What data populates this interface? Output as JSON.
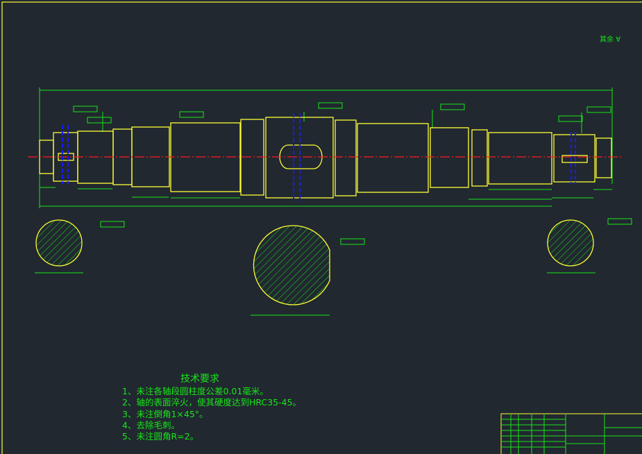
{
  "colors": {
    "background": "#212830",
    "outline": "#ffff33",
    "dimension": "#19e619",
    "centerline": "#ff1a1a",
    "hidden_axis": "#1a1aff"
  },
  "roughness_note": {
    "label": "其余",
    "icon": "surface-roughness-symbol"
  },
  "technical_requirements": {
    "title": "技术要求",
    "items": [
      "1、未注各轴段圆柱度公差0.01毫米。",
      "2、轴的表面淬火，使其硬度达到HRC35-45。",
      "3、未注倒角1×45°。",
      "4、去除毛刺。",
      "5、未注圆角R=2。"
    ]
  }
}
